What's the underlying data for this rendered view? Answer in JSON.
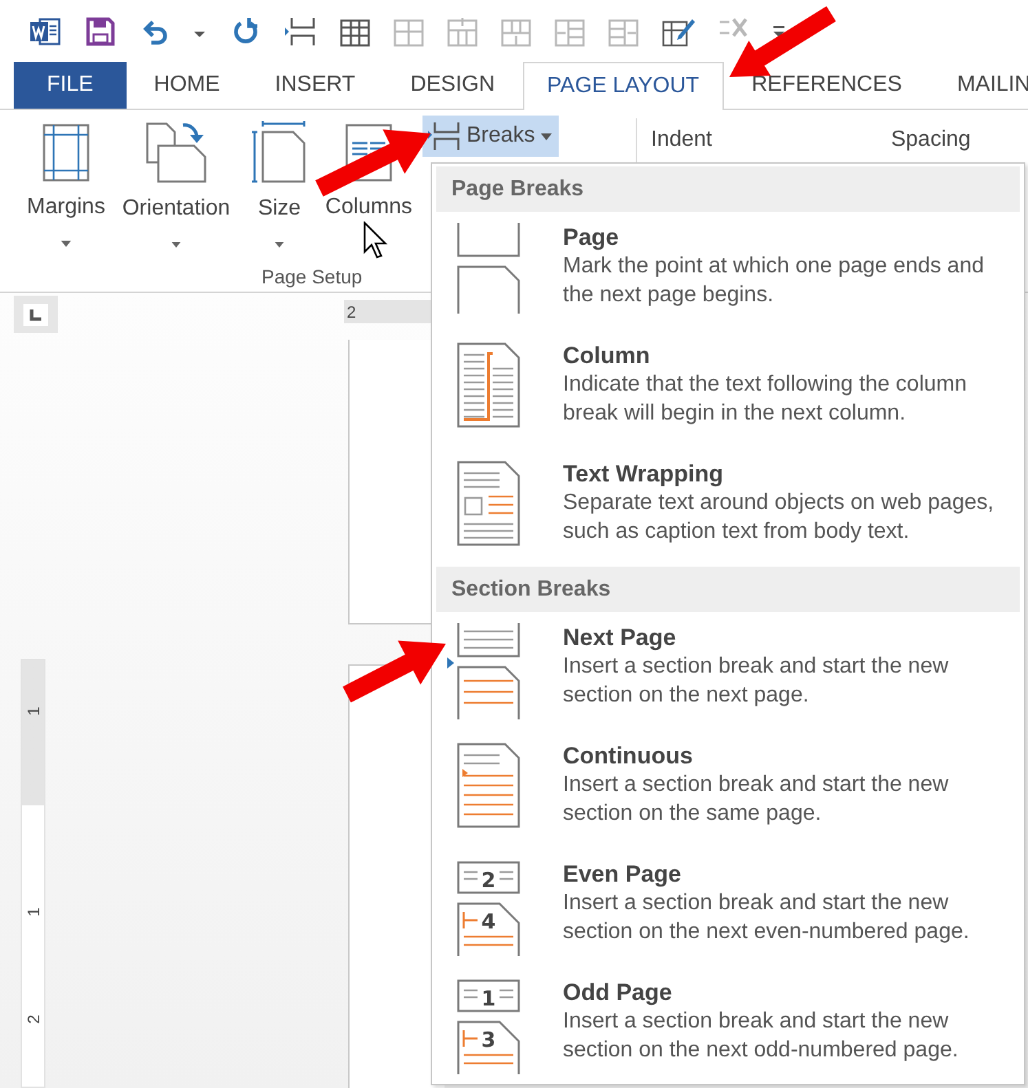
{
  "quick_access_toolbar": [
    {
      "kind": "word",
      "disabled": false
    },
    {
      "kind": "save",
      "disabled": false
    },
    {
      "kind": "undo",
      "disabled": false
    },
    {
      "kind": "undo_menu",
      "disabled": false
    },
    {
      "kind": "repeat",
      "disabled": false
    },
    {
      "kind": "table_break",
      "disabled": false
    },
    {
      "kind": "table",
      "disabled": false
    },
    {
      "kind": "split",
      "disabled": true
    },
    {
      "kind": "insert_above",
      "disabled": true
    },
    {
      "kind": "insert_below",
      "disabled": true
    },
    {
      "kind": "insert_left",
      "disabled": true
    },
    {
      "kind": "insert_right",
      "disabled": true
    },
    {
      "kind": "draw_table",
      "disabled": false
    },
    {
      "kind": "delete",
      "disabled": true
    },
    {
      "kind": "customize",
      "disabled": false
    }
  ],
  "tabs": [
    {
      "label": "FILE",
      "kind": "file",
      "selected": false
    },
    {
      "label": "HOME",
      "kind": "tab",
      "selected": false
    },
    {
      "label": "INSERT",
      "kind": "tab",
      "selected": false
    },
    {
      "label": "DESIGN",
      "kind": "tab",
      "selected": false
    },
    {
      "label": "PAGE LAYOUT",
      "kind": "tab",
      "selected": true
    },
    {
      "label": "REFERENCES",
      "kind": "tab",
      "selected": false
    },
    {
      "label": "MAILIN",
      "kind": "tab",
      "selected": false
    }
  ],
  "ribbon": {
    "page_setup": {
      "label": "Page Setup",
      "buttons": [
        {
          "label": "Margins",
          "kind": "margins"
        },
        {
          "label": "Orientation",
          "kind": "orientation"
        },
        {
          "label": "Size",
          "kind": "size"
        },
        {
          "label": "Columns",
          "kind": "columns"
        }
      ],
      "breaks": {
        "label": "Breaks",
        "expanded": true
      }
    },
    "paragraph": {
      "headers": [
        "Indent",
        "Spacing"
      ]
    }
  },
  "document": {
    "horizontal_ruler": [
      "2"
    ],
    "vertical_ruler": [
      "1",
      "1",
      "2"
    ]
  },
  "breaks_menu": {
    "sections": [
      {
        "title": "Page Breaks",
        "items": [
          {
            "kind": "page",
            "title": "Page",
            "description": "Mark the point at which one page ends and the next page begins."
          },
          {
            "kind": "column",
            "title": "Column",
            "description": "Indicate that the text following the column break will begin in the next column."
          },
          {
            "kind": "text_wrapping",
            "title": "Text Wrapping",
            "description": "Separate text around objects on web pages, such as caption text from body text."
          }
        ]
      },
      {
        "title": "Section Breaks",
        "items": [
          {
            "kind": "next_page",
            "title": "Next Page",
            "description": "Insert a section break and start the new section on the next page."
          },
          {
            "kind": "continuous",
            "title": "Continuous",
            "description": "Insert a section break and start the new section on the same page."
          },
          {
            "kind": "even_page",
            "title": "Even Page",
            "description": "Insert a section break and start the new section on the next even-numbered page.",
            "icon_numbers": [
              "2",
              "4"
            ]
          },
          {
            "kind": "odd_page",
            "title": "Odd Page",
            "description": "Insert a section break and start the new section on the next odd-numbered page.",
            "icon_numbers": [
              "1",
              "3"
            ]
          }
        ]
      }
    ]
  }
}
